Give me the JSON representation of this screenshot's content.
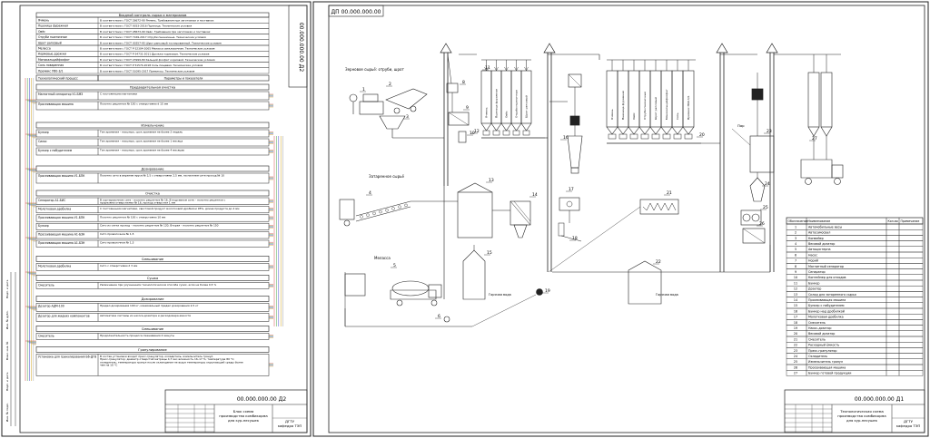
{
  "left_sheet": {
    "stamp_code": "00.000.000.00 Д2",
    "title_code": "00.000.000.00 Д2",
    "title_text": [
      "Блок схема",
      "производства комбикорма",
      "для кур-несушек"
    ],
    "stamp_small": [
      "ДГТУ",
      "кафедра ТЭП"
    ],
    "margin_labels": [
      "Инв. № подл.",
      "Подп. и дата",
      "Взам. инв. №",
      "Инв. № дубл.",
      "Подп. и дата"
    ],
    "sections": [
      {
        "key": "input",
        "title": "Входной контроль сырья и материалов"
      },
      {
        "key": "tech",
        "title": "Технологический процесс"
      },
      {
        "key": "params",
        "title": "Параметры и показатели"
      },
      {
        "key": "prep",
        "title": "Предварительная очистка"
      },
      {
        "key": "grind",
        "title": "Измельчение"
      },
      {
        "key": "dose",
        "title": "Дозирование"
      },
      {
        "key": "clean",
        "title": "Очистка"
      },
      {
        "key": "mix1",
        "title": "Смешивание"
      },
      {
        "key": "dry",
        "title": "Сушка"
      },
      {
        "key": "dose2",
        "title": "Дозирование"
      },
      {
        "key": "mix2",
        "title": "Смешивание"
      },
      {
        "key": "gran",
        "title": "Гранулирование"
      }
    ],
    "input_rows": [
      {
        "name": "Ячмень",
        "text": "В соответствии с ГОСТ 28672-90 Ячмень. Требования при заготовках и поставках"
      },
      {
        "name": "Пшеница фуражная",
        "text": "В соответствии с ГОСТ 9353-2016 Пшеница. Технические условия"
      },
      {
        "name": "Овёс",
        "text": "В соответствии с ГОСТ 28673-90 Овёс. Требования при заготовках и поставках"
      },
      {
        "name": "Отруби пшеничные",
        "text": "В соответствии с ГОСТ 7169-2017 Отруби пшеничные. Технические условия"
      },
      {
        "name": "Шрот рапсовый",
        "text": "В соответствии с ГОСТ 30257-95 Шрот рапсовый тостированный. Технические условия"
      },
      {
        "name": "Мелассa",
        "text": "В соответствии с ГОСТ Р 52304-2005 Меласса свекловичная. Технические условия"
      },
      {
        "name": "Кормовые дрожжи",
        "text": "В соответствии с ГОСТ Р 54731-2011 Дрожжи кормовые. Технические условия"
      },
      {
        "name": "Монокальцийфосфат",
        "text": "В соответствии с ГОСТ 23999-80 Кальций фосфат кормовой. Технические условия"
      },
      {
        "name": "Соль поваренная",
        "text": "В соответствии с ГОСТ Р 51574-2018 Соль пищевая. Технические условия"
      },
      {
        "name": "Премикс П60-3/1",
        "text": "В соответствии с ГОСТ 51095-2017 Премиксы. Технические условия"
      }
    ],
    "prep_rows": [
      {
        "name": "Магнитный сепаратор У1-БМЗ",
        "text": "С постоянными магнитами"
      },
      {
        "name": "Просеивающая машина",
        "text": "Полотно решетное № 150 с отверстиями d 15 мм"
      }
    ],
    "grind_rows": [
      {
        "name": "Бункер",
        "text": "Тип хранения – насыпью, срок хранения не более 2 недель"
      },
      {
        "name": "Силос",
        "text": "Тип хранения – насыпью, срок хранения не более 1 месяца"
      },
      {
        "name": "Бункер с побудителем",
        "text": "Тип хранения – насыпью, срок хранения не более 4 месяцев"
      }
    ],
    "dose_rows": [
      {
        "name": "Просеивающая машина У1-БПК",
        "text": "Полотно сито в верхнем ярусе № 2,5 с отверстиями 2,5 мм, на нижнем сите проход № 10"
      }
    ],
    "clean_rows": [
      {
        "name": "Сепаратор А1-БИС",
        "text": "В сортировочном ситe – полотно решетное № 16, В подсевном сите – полотно решетное с прорезями отверстиями № 16, проход отверстия 1 мм"
      },
      {
        "name": "Молотковая дробилка",
        "text": "С постоянными магнитами, хвостовой продукт молотковой дробилки 95%, длина продукта до 4 мм"
      },
      {
        "name": "Просеивающая машина У1-БПК",
        "text": "Полотно решетное № 100 с отверстиями 10 мм"
      },
      {
        "name": "Бункер",
        "text": "Сито из сетки проход – полотно решетное № 120, Вторая – полотно решетное № 150"
      },
      {
        "name": "Просеивающая машина А1-БЗН",
        "text": "Сито проволочное № 1,5"
      },
      {
        "name": "Просеивающая машина А1-БЗН",
        "text": "Сито проволочное № 1,5"
      }
    ],
    "mix1_rows": [
      {
        "name": "Молотковая дробилка",
        "text": "Сито с отверстиями d 3 мм"
      }
    ],
    "dry_rows": [
      {
        "name": "Смеситель",
        "text": "Увлажнение при улучшенном технологическом способе сухих, если не более 0,5 %"
      }
    ],
    "dose2_rows": [
      {
        "name": "Дозатор АДМ-100",
        "text": "Предел дозирования 100 кг, минимальный предел дозирования 2,5 кг"
      },
      {
        "name": "Дозатор для жидких компонентов",
        "text": "Автоматика системы из насоса-дозатора и расходомера емкости"
      }
    ],
    "mix2_rows": [
      {
        "name": "Смеситель",
        "text": "Продолжительность процесса смешивания 4 минуты"
      }
    ],
    "gran_rows": [
      {
        "name": "Установка для гранулирования Б6-ДГВ",
        "text": "В состав установки входит пресс-гранулятор, охладитель, измельчитель гранул. Пресс-гранулятор: диаметр отверстий матрицы 4,7 мм; влажность 16–17 %; температура 80 °С; охладитель: температура гранул после охлаждения не выше температуры окружающей среды более чем на 10 °С"
      }
    ]
  },
  "right_sheet": {
    "stamp_code": "ДП 00.000.000.00",
    "title_code": "00.000.000.00 Д1",
    "title_text": [
      "Технологическая схема",
      "производства комбикорма",
      "для кур-несушек"
    ],
    "stamp_small": [
      "ДГТУ",
      "кафедра ТЭП"
    ],
    "diagram_labels": {
      "grain_intake": "Зерновое сырьё: отруби, шрот",
      "packaged": "Затаренное сырьё",
      "molasses": "Меласса",
      "hot_water_1": "Горячая вода",
      "hot_water_2": "Горячая вода",
      "steam": "Пар"
    },
    "silo_labels_a": [
      "Ячмень",
      "Пшеница фуражная",
      "Овёс",
      "Отруби пшеничные",
      "Шрот рапсовый"
    ],
    "silo_labels_b": [
      "Ячмень",
      "Пшеница фуражная",
      "Овёс",
      "Отруби пшеничные",
      "Шрот рапсовый",
      "Монокальцийфосфат",
      "Соль",
      "Премикс П60-3/1"
    ],
    "equipment_numbers": [
      "1",
      "2",
      "3",
      "4",
      "5",
      "6",
      "7",
      "8",
      "9",
      "10",
      "11",
      "12",
      "13",
      "14",
      "15",
      "16",
      "17",
      "18",
      "19",
      "20",
      "21",
      "22",
      "23",
      "24",
      "25",
      "26",
      "27"
    ],
    "table_header": [
      "Обозначение",
      "Наименование",
      "Кол-во",
      "Примечание"
    ],
    "equipment": [
      {
        "pos": "1",
        "name": "Автомобильные весы"
      },
      {
        "pos": "2",
        "name": "Автосамосвал"
      },
      {
        "pos": "3",
        "name": "Конвейер"
      },
      {
        "pos": "4",
        "name": "Весовой дозатор"
      },
      {
        "pos": "5",
        "name": "Автоцистерна"
      },
      {
        "pos": "6",
        "name": "Насос"
      },
      {
        "pos": "7",
        "name": "Норий"
      },
      {
        "pos": "8",
        "name": "Магнитный сепаратор"
      },
      {
        "pos": "9",
        "name": "Сепаратор"
      },
      {
        "pos": "10",
        "name": "Контейнер для отходов"
      },
      {
        "pos": "11",
        "name": "Бункер"
      },
      {
        "pos": "12",
        "name": "Дозатор"
      },
      {
        "pos": "13",
        "name": "Склад для затаренного сырья"
      },
      {
        "pos": "14",
        "name": "Просеивающая машина"
      },
      {
        "pos": "15",
        "name": "Бункер с побудителем"
      },
      {
        "pos": "16",
        "name": "Бункер над дробилкой"
      },
      {
        "pos": "17",
        "name": "Молотковая дробилка"
      },
      {
        "pos": "18",
        "name": "Смеситель"
      },
      {
        "pos": "19",
        "name": "Насос-дозатор"
      },
      {
        "pos": "20",
        "name": "Весовой дозатор"
      },
      {
        "pos": "21",
        "name": "Смеситель"
      },
      {
        "pos": "22",
        "name": "Расходный ёмкость"
      },
      {
        "pos": "23",
        "name": "Пресс-гранулятор"
      },
      {
        "pos": "24",
        "name": "Охладитель"
      },
      {
        "pos": "25",
        "name": "Измельчитель гранул"
      },
      {
        "pos": "26",
        "name": "Просеивающая машина"
      },
      {
        "pos": "27",
        "name": "Бункер готовой продукции"
      }
    ]
  }
}
